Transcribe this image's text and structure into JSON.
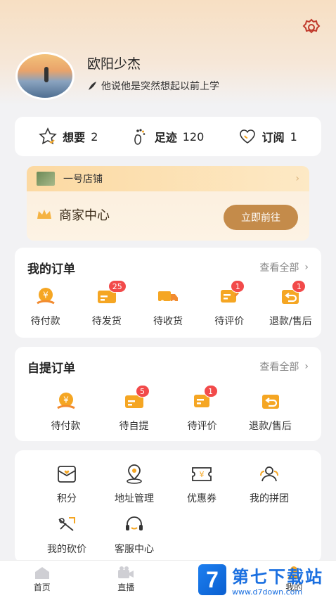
{
  "profile": {
    "name": "欧阳少杰",
    "bio": "他说他是突然想起以前上学"
  },
  "stats": [
    {
      "label": "想要",
      "count": "2",
      "icon": "star-icon"
    },
    {
      "label": "足迹",
      "count": "120",
      "icon": "footprint-icon"
    },
    {
      "label": "订阅",
      "count": "1",
      "icon": "heart-icon"
    }
  ],
  "shop": {
    "name": "一号店铺",
    "merchant_label": "商家中心",
    "goto_label": "立即前往"
  },
  "orders": {
    "title": "我的订单",
    "see_all": "查看全部",
    "items": [
      {
        "label": "待付款",
        "badge": "",
        "icon": "payment-icon"
      },
      {
        "label": "待发货",
        "badge": "25",
        "icon": "card-icon"
      },
      {
        "label": "待收货",
        "badge": "",
        "icon": "truck-icon"
      },
      {
        "label": "待评价",
        "badge": "1",
        "icon": "review-icon"
      },
      {
        "label": "退款/售后",
        "badge": "1",
        "icon": "refund-icon"
      }
    ]
  },
  "pickup": {
    "title": "自提订单",
    "see_all": "查看全部",
    "items": [
      {
        "label": "待付款",
        "badge": "",
        "icon": "payment-icon"
      },
      {
        "label": "待自提",
        "badge": "5",
        "icon": "card-icon"
      },
      {
        "label": "待评价",
        "badge": "1",
        "icon": "review-icon"
      },
      {
        "label": "退款/售后",
        "badge": "",
        "icon": "refund-icon"
      }
    ]
  },
  "services": {
    "items": [
      {
        "label": "积分",
        "icon": "points-icon"
      },
      {
        "label": "地址管理",
        "icon": "location-icon"
      },
      {
        "label": "优惠券",
        "icon": "coupon-icon"
      },
      {
        "label": "我的拼团",
        "icon": "group-icon"
      },
      {
        "label": "我的砍价",
        "icon": "bargain-icon"
      },
      {
        "label": "客服中心",
        "icon": "headset-icon"
      }
    ]
  },
  "nav": {
    "tabs": [
      {
        "label": "首页"
      },
      {
        "label": "直播"
      },
      {
        "label": ""
      },
      {
        "label": "我的"
      }
    ]
  },
  "watermark": {
    "logo": "7",
    "text": "第七下载站",
    "url": "www.d7down.com"
  },
  "colors": {
    "accent": "#f5a623",
    "badge": "#f24a4a",
    "goto_button": "#c48b4a"
  }
}
